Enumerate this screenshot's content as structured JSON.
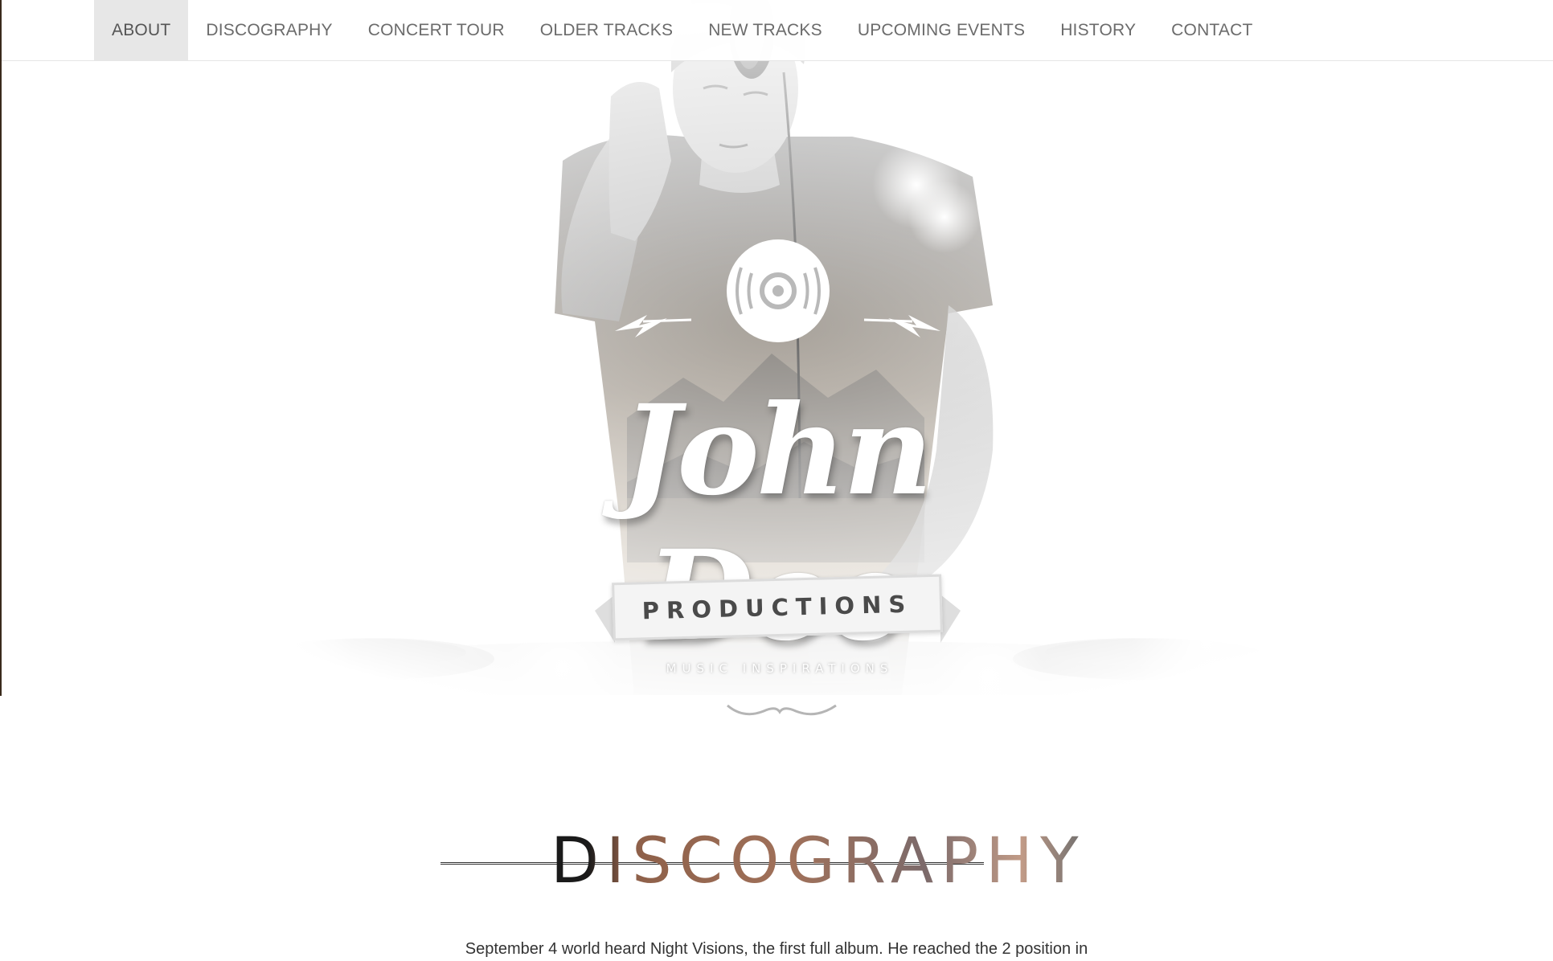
{
  "nav": {
    "items": [
      {
        "label": "ABOUT",
        "active": true
      },
      {
        "label": "DISCOGRAPHY",
        "active": false
      },
      {
        "label": "CONCERT TOUR",
        "active": false
      },
      {
        "label": "OLDER TRACKS",
        "active": false
      },
      {
        "label": "NEW TRACKS",
        "active": false
      },
      {
        "label": "UPCOMING EVENTS",
        "active": false
      },
      {
        "label": "HISTORY",
        "active": false
      },
      {
        "label": "CONTACT",
        "active": false
      }
    ]
  },
  "hero": {
    "brand_name": "John Doe",
    "banner_text": "PRODUCTIONS",
    "tagline": "MUSIC INSPIRATIONS",
    "scroll_icon": "arrow-down-icon",
    "vinyl_icon": "vinyl-record-icon"
  },
  "discography": {
    "title": "DISCOGRAPHY",
    "text": "September 4 world heard Night Visions, the first full album. He reached the 2 position in"
  },
  "colors": {
    "nav_text": "#6b6b6b",
    "nav_active_bg": "#e7e7e7",
    "title_accent": "#a0715a",
    "body_text": "#333333"
  }
}
